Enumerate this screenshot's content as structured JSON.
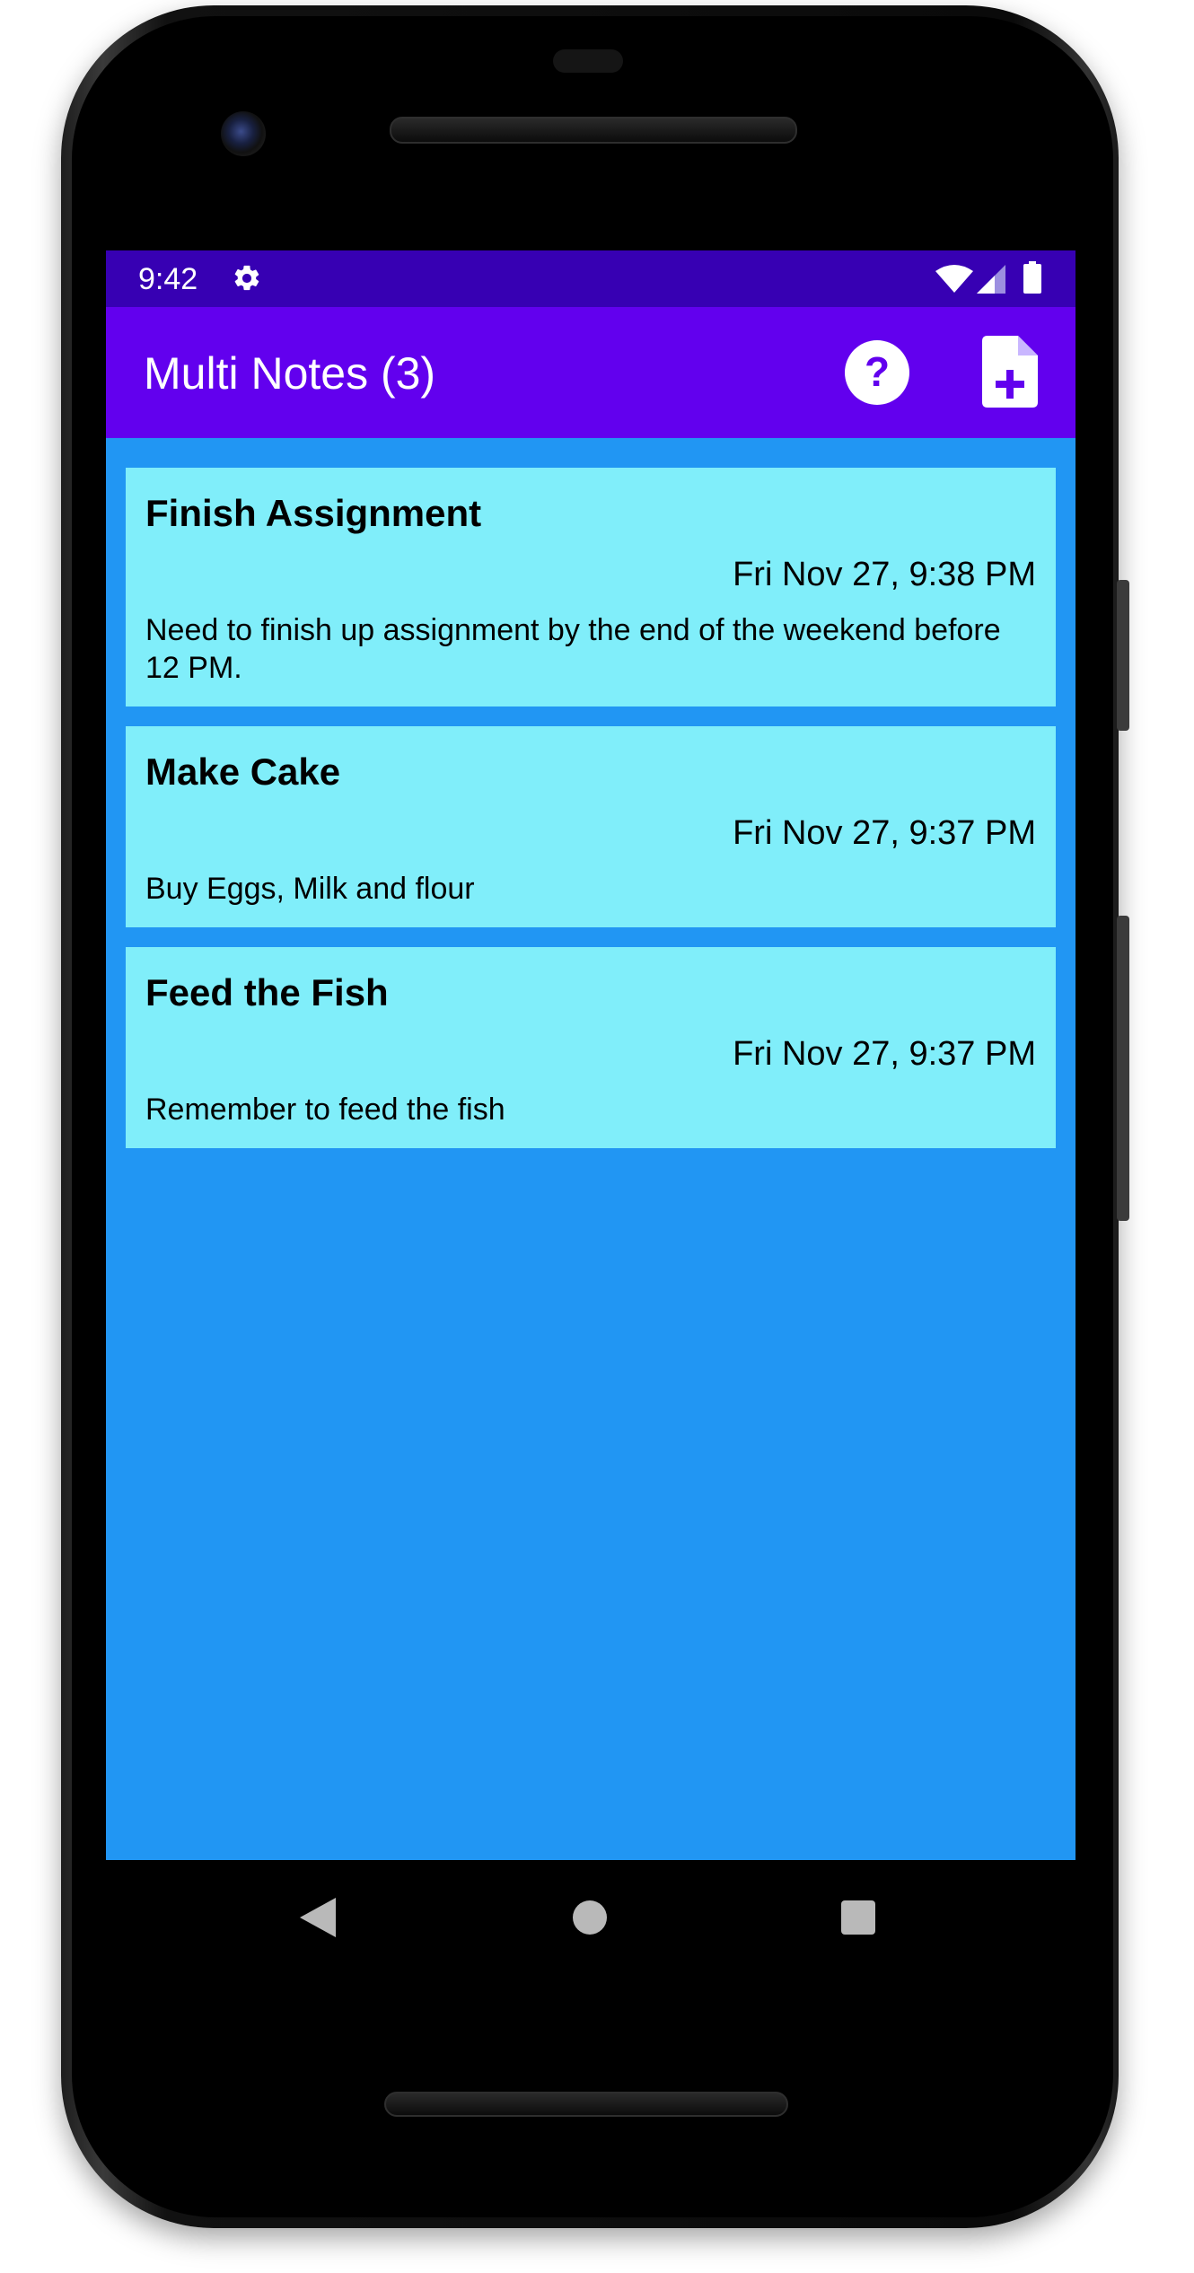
{
  "status_bar": {
    "time": "9:42",
    "icons": [
      "gear-icon",
      "wifi-icon",
      "signal-icon",
      "battery-icon"
    ]
  },
  "app_bar": {
    "title": "Multi Notes (3)",
    "actions": [
      {
        "name": "help",
        "icon": "help-circle-icon"
      },
      {
        "name": "new-note",
        "icon": "new-note-icon"
      }
    ]
  },
  "notes": [
    {
      "title": "Finish Assignment",
      "date": "Fri Nov 27, 9:38 PM",
      "body": "Need to finish up assignment by the end of the weekend before 12 PM."
    },
    {
      "title": "Make Cake",
      "date": "Fri Nov 27, 9:37 PM",
      "body": "Buy Eggs, Milk and flour"
    },
    {
      "title": "Feed the Fish",
      "date": "Fri Nov 27, 9:37 PM",
      "body": "Remember to feed the fish"
    }
  ],
  "nav_bar": {
    "buttons": [
      "back-icon",
      "home-icon",
      "recents-icon"
    ]
  },
  "colors": {
    "status_bar": "#3700b3",
    "app_bar": "#6200ee",
    "background": "#2196f3",
    "card": "#80eefa",
    "icon_glyph": "#6200ee"
  }
}
